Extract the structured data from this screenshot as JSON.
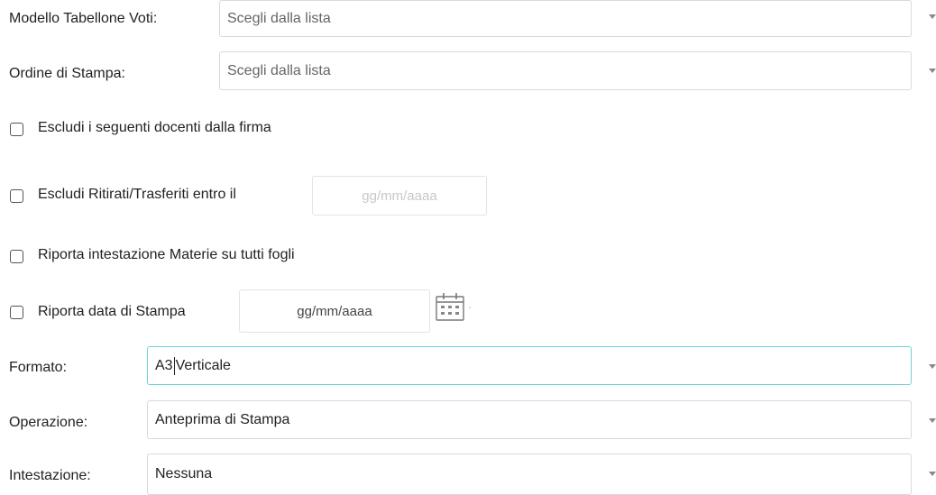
{
  "form": {
    "modello": {
      "label": "Modello Tabellone Voti:",
      "placeholder": "Scegli dalla lista"
    },
    "ordine": {
      "label": "Ordine di Stampa:",
      "placeholder": "Scegli dalla lista"
    },
    "escludi_docenti": {
      "label": "Escludi i seguenti docenti dalla firma",
      "checked": false
    },
    "escludi_ritirati": {
      "label": "Escludi Ritirati/Trasferiti entro il",
      "checked": false,
      "date_placeholder": "gg/mm/aaaa"
    },
    "riporta_intestazione": {
      "label": "Riporta intestazione Materie su tutti fogli",
      "checked": false
    },
    "riporta_data": {
      "label": "Riporta data di Stampa",
      "checked": false,
      "date_value": "gg/mm/aaaa"
    },
    "formato": {
      "label": "Formato:",
      "value_before_cursor": "A3",
      "value_after_cursor": "Verticale"
    },
    "operazione": {
      "label": "Operazione:",
      "value": "Anteprima di Stampa"
    },
    "intestazione": {
      "label": "Intestazione:",
      "value": "Nessuna"
    }
  },
  "icons": {
    "calendar": "calendar-icon",
    "dropdown": "chevron-down-icon"
  },
  "colors": {
    "focus_border": "#6ed3d8",
    "input_border": "#d9d9d9"
  }
}
